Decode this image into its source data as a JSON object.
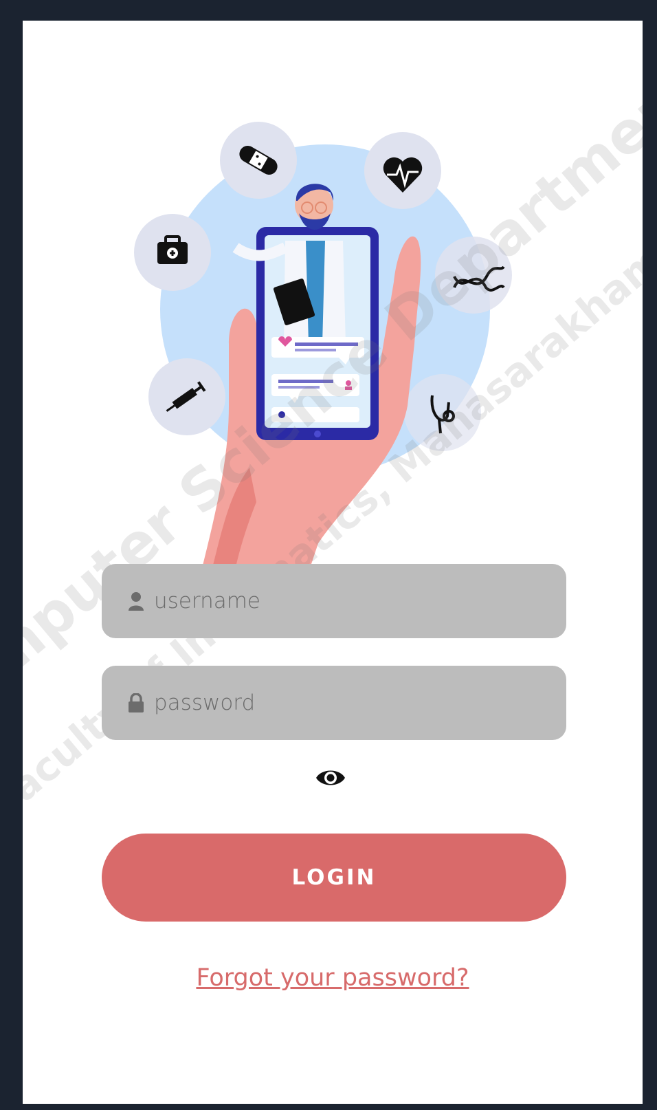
{
  "login_form": {
    "username_placeholder": "username",
    "password_placeholder": "password",
    "login_label": "LOGIN",
    "forgot_label": "Forgot your password?"
  },
  "watermark": {
    "line1": "Computer Science Department",
    "line2": "Faculty of Informatics, Mahasarakham University"
  },
  "icons": {
    "user": "user-icon",
    "lock": "lock-icon",
    "eye": "eye-icon"
  },
  "colors": {
    "login_button": "#d96a6a",
    "link": "#d76b6b",
    "field_bg": "#bcbcbc",
    "frame": "#1b2330"
  }
}
